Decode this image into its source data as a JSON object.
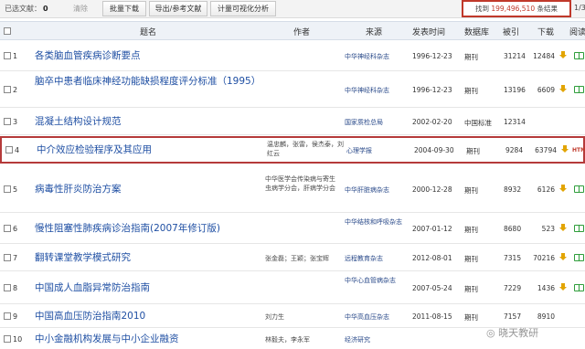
{
  "toolbar": {
    "selected_label": "已选文献：",
    "selected_count": "0",
    "clear_label": "清除",
    "batch_download": "批量下载",
    "export_refs": "导出/参考文献",
    "visual_analysis": "计量可视化分析",
    "found_prefix": "找到",
    "found_count": "199,496,510",
    "found_suffix": "条结果",
    "page_indicator": "1/3"
  },
  "columns": {
    "title": "题名",
    "author": "作者",
    "source": "来源",
    "date": "发表时间",
    "database": "数据库",
    "cited": "被引",
    "downloads": "下载",
    "read": "阅读"
  },
  "rows": [
    {
      "idx": "1",
      "title": "各类脑血管疾病诊断要点",
      "author": "",
      "source": "中华神经科杂志",
      "date": "1996-12-23",
      "db": "期刊",
      "cited": "31214",
      "downloads": "12484"
    },
    {
      "idx": "2",
      "title": "脑卒中患者临床神经功能缺损程度评分标准（1995）",
      "author": "",
      "source": "中华神经科杂志",
      "date": "1996-12-23",
      "db": "期刊",
      "cited": "13196",
      "downloads": "6609"
    },
    {
      "idx": "3",
      "title": "混凝土结构设计规范",
      "author": "",
      "source": "国家质检总局",
      "date": "2002-02-20",
      "db": "中国标准",
      "cited": "12314",
      "downloads": ""
    },
    {
      "idx": "4",
      "title": "中介效应检验程序及其应用",
      "author": "温忠麟，张雷，侯杰泰，刘红云",
      "source": "心理学报",
      "date": "2004-09-30",
      "db": "期刊",
      "cited": "9284",
      "downloads": "63794"
    },
    {
      "idx": "5",
      "title": "病毒性肝炎防治方案",
      "author": "中华医学会传染病与寄生虫病学分会，肝病学分会",
      "source": "中华肝脏病杂志",
      "date": "2000-12-28",
      "db": "期刊",
      "cited": "8932",
      "downloads": "6126"
    },
    {
      "idx": "6",
      "title": "慢性阻塞性肺疾病诊治指南(2007年修订版)",
      "author": "",
      "source": "中华结核和呼吸杂志",
      "date": "2007-01-12",
      "db": "期刊",
      "cited": "8680",
      "downloads": "523"
    },
    {
      "idx": "7",
      "title": "翻转课堂教学模式研究",
      "author": "张金磊；王颖；张宝辉",
      "source": "远程教育杂志",
      "date": "2012-08-01",
      "db": "期刊",
      "cited": "7315",
      "downloads": "70216"
    },
    {
      "idx": "8",
      "title": "中国成人血脂异常防治指南",
      "author": "",
      "source": "中华心血管病杂志",
      "date": "2007-05-24",
      "db": "期刊",
      "cited": "7229",
      "downloads": "1436"
    },
    {
      "idx": "9",
      "title": "中国高血压防治指南2010",
      "author": "刘力生",
      "source": "中华高血压杂志",
      "date": "2011-08-15",
      "db": "期刊",
      "cited": "7157",
      "downloads": "8910"
    },
    {
      "idx": "10",
      "title": "中小企业融资",
      "author": "林毅夫，李永军",
      "source": "经济研究",
      "date": "",
      "db": "",
      "cited": "",
      "downloads": ""
    }
  ],
  "row10_title_full": "中小金融机构发展与中小企业融资",
  "watermark": "晓天教研"
}
